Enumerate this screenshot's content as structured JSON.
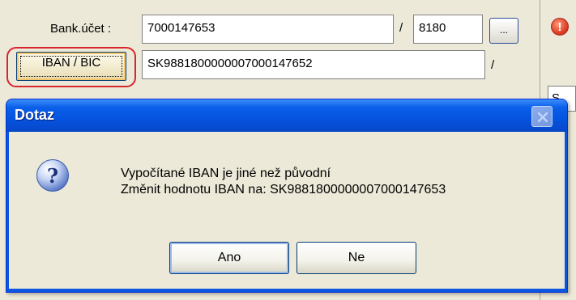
{
  "form": {
    "bank_account_label": "Bank.účet :",
    "bank_account_value": "7000147653",
    "separator": "/",
    "bank_code_value": "8180",
    "browse_button_label": "...",
    "iban_button_label": "IBAN / BIC",
    "iban_value": "SK9881800000007000147652",
    "iban_separator": "/",
    "right_field_fragment": "S"
  },
  "dialog": {
    "title": "Dotaz",
    "message_line1": "Vypočítané IBAN je jiné než původní",
    "message_line2": "Změnit hodnotu IBAN na: SK9881800000007000147653",
    "yes_label": "Ano",
    "no_label": "Ne",
    "icon": "question-icon"
  },
  "colors": {
    "titlebar": "#0554e0",
    "highlight_ring": "#d7262c",
    "dialog_body": "#ece9d8"
  }
}
